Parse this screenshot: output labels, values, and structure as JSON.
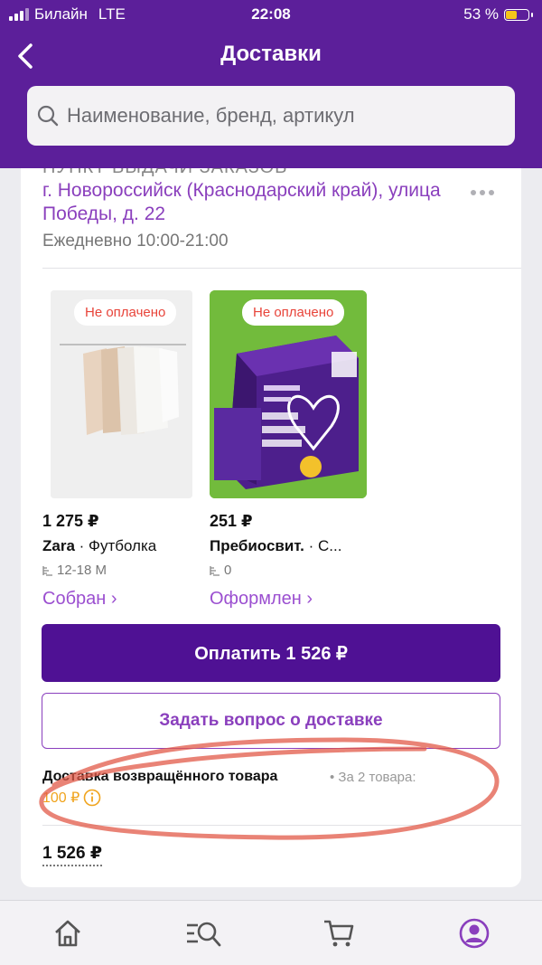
{
  "status_bar": {
    "carrier": "Билайн",
    "network": "LTE",
    "time": "22:08",
    "battery": "53 %",
    "battery_level": 0.53
  },
  "header": {
    "title": "Доставки",
    "search_placeholder": "Наименование, бренд, артикул"
  },
  "pickup": {
    "partial_title": "ПУНКТ ВЫДАЧИ ЗАКАЗОВ",
    "address": "г. Новороссийск (Краснодарский край), улица Победы, д. 22",
    "hours": "Ежедневно 10:00-21:00"
  },
  "products": [
    {
      "badge": "Не оплачено",
      "price": "1 275 ₽",
      "brand": "Zara",
      "name": "Футболка",
      "size": "12-18 M",
      "status": "Собран ›"
    },
    {
      "badge": "Не оплачено",
      "price": "251 ₽",
      "brand": "Пребиосвит.",
      "name": "С...",
      "size": "0",
      "status": "Оформлен ›"
    }
  ],
  "actions": {
    "pay": "Оплатить 1 526 ₽",
    "ask": "Задать вопрос о доставке"
  },
  "return_delivery": {
    "title": "Доставка возвращённого товара",
    "meta": "• За 2 товара:",
    "price": "100 ₽"
  },
  "total": "1 526 ₽",
  "colors": {
    "brand": "#5c1f9a",
    "accent": "#8a3fbd",
    "pay_button": "#4f1194",
    "badge_text": "#e8443a",
    "return_price": "#f0a41e"
  },
  "tabbar": [
    "home-icon",
    "catalog-search-icon",
    "cart-icon",
    "profile-icon"
  ]
}
